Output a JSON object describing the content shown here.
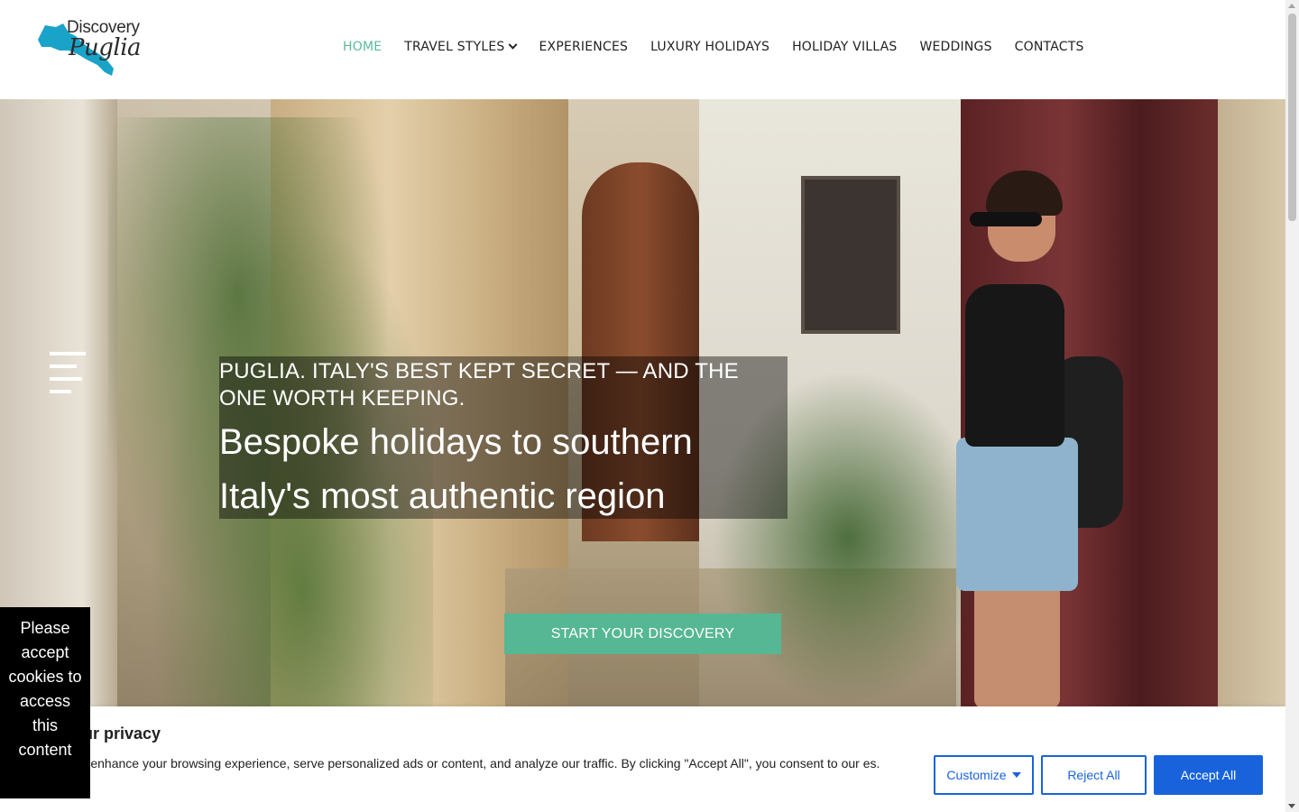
{
  "header": {
    "logo": {
      "line1": "Discovery",
      "line2": "Puglia",
      "icon": "puglia-map-icon",
      "color": "#1aa3c9"
    },
    "nav": [
      {
        "label": "HOME",
        "active": true
      },
      {
        "label": "TRAVEL STYLES",
        "has_dropdown": true
      },
      {
        "label": "EXPERIENCES"
      },
      {
        "label": "LUXURY HOLIDAYS"
      },
      {
        "label": "HOLIDAY VILLAS"
      },
      {
        "label": "WEDDINGS"
      },
      {
        "label": "CONTACTS"
      }
    ],
    "active_color": "#5bb8a0"
  },
  "hero": {
    "subtitle": "PUGLIA. ITALY'S BEST KEPT SECRET — AND THE ONE WORTH KEEPING.",
    "title": "Bespoke holidays to southern Italy's most authentic region",
    "cta": "START YOUR DISCOVERY",
    "cta_color": "#56b794",
    "menu_icon": "hamburger-menu-icon"
  },
  "cookie_banner": {
    "title": "e your privacy",
    "text": "kies to enhance your browsing experience, serve personalized ads or content, and analyze our traffic. By clicking \"Accept All\", you consent to our es.",
    "customize": "Customize",
    "reject": "Reject All",
    "accept": "Accept All",
    "accent": "#1863dc"
  },
  "blocked_notice": "Please accept cookies to access this content"
}
